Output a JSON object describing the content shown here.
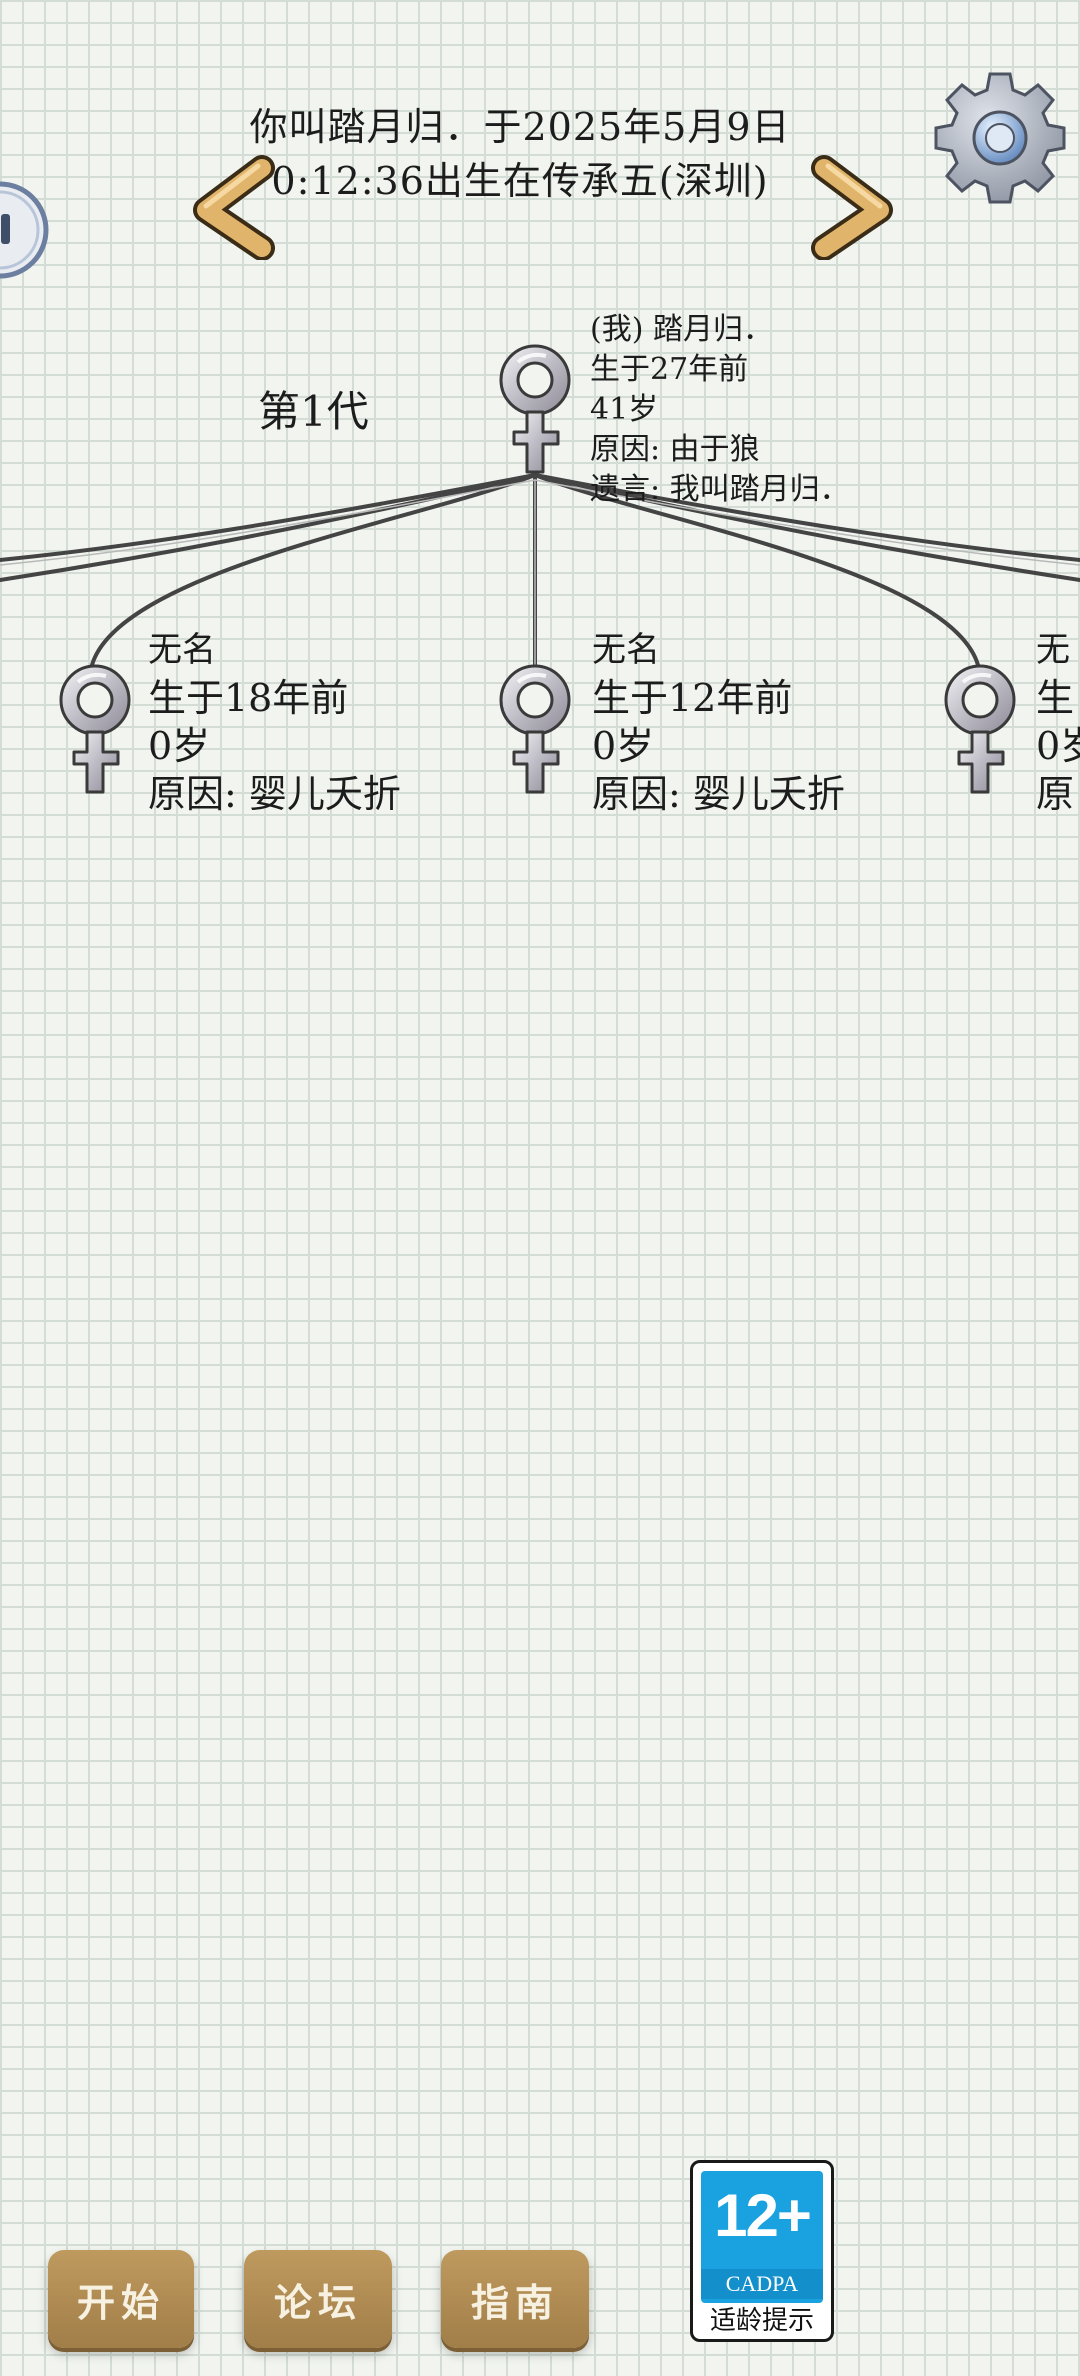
{
  "header": {
    "line1": "你叫踏月归．于2025年5月9日",
    "line2": "0:12:36出生在传承五(深圳)"
  },
  "generation": {
    "label": "第1代"
  },
  "me": {
    "line1": "(我) 踏月归．",
    "line2": "生于27年前",
    "line3": "41岁",
    "line4": "原因: 由于狼",
    "line5": "遗言: 我叫踏月归．"
  },
  "children": [
    {
      "name": "无名",
      "born": "生于18年前",
      "age": "0岁",
      "reason": "原因: 婴儿夭折"
    },
    {
      "name": "无名",
      "born": "生于12年前",
      "age": "0岁",
      "reason": "原因: 婴儿夭折"
    },
    {
      "name": "无",
      "born": "生",
      "age": "0岁",
      "reason": "原"
    }
  ],
  "buttons": {
    "start": "开始",
    "forum": "论坛",
    "guide": "指南"
  },
  "age_badge": {
    "rating": "12+",
    "org": "CADPA",
    "caption": "适龄提示"
  },
  "icons": {
    "settings": "gear-icon",
    "pause": "pause-icon",
    "prev": "chevron-left-icon",
    "next": "chevron-right-icon",
    "female": "female-symbol-icon"
  },
  "colors": {
    "grid_background": "#f1f4ef",
    "grid_line": "#d3dcd5",
    "button": "#b08c54",
    "arrow": "#e0b46a",
    "badge_blue": "#1aa1e0"
  }
}
